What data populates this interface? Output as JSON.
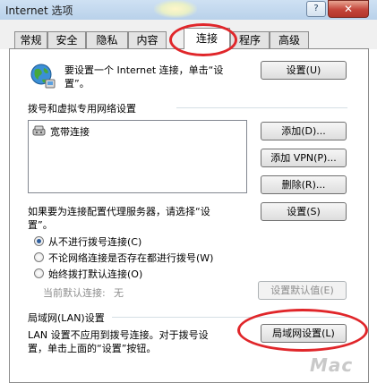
{
  "window": {
    "title": "Internet 选项",
    "help_label": "?",
    "close_label": "✕"
  },
  "tabs": [
    {
      "label": "常规"
    },
    {
      "label": "安全"
    },
    {
      "label": "隐私"
    },
    {
      "label": "内容"
    },
    {
      "label": "连接",
      "active": true
    },
    {
      "label": "程序"
    },
    {
      "label": "高级"
    }
  ],
  "setup": {
    "text_line1": "要设置一个 Internet 连接，单击“设",
    "text_line2": "置”。",
    "button": "设置(U)"
  },
  "dialup": {
    "header": "拨号和虚拟专用网络设置",
    "connections": [
      {
        "name": "宽带连接"
      }
    ],
    "add_button": "添加(D)...",
    "add_vpn_button": "添加 VPN(P)...",
    "remove_button": "删除(R)...",
    "proxy_text_line1": "如果要为连接配置代理服务器，请选择“设",
    "proxy_text_line2": "置”。",
    "settings_button": "设置(S)",
    "options": [
      {
        "label": "从不进行拨号连接(C)",
        "selected": true
      },
      {
        "label": "不论网络连接是否存在都进行拨号(W)",
        "selected": false
      },
      {
        "label": "始终拨打默认连接(O)",
        "selected": false
      }
    ],
    "current_default_label": "当前默认连接:",
    "current_default_value": "无",
    "set_default_button": "设置默认值(E)"
  },
  "lan": {
    "header": "局域网(LAN)设置",
    "text_line1": "LAN 设置不应用到拨号连接。对于拨号设",
    "text_line2": "置，单击上面的“设置”按钮。",
    "button": "局域网设置(L)"
  },
  "watermark": "Mac"
}
